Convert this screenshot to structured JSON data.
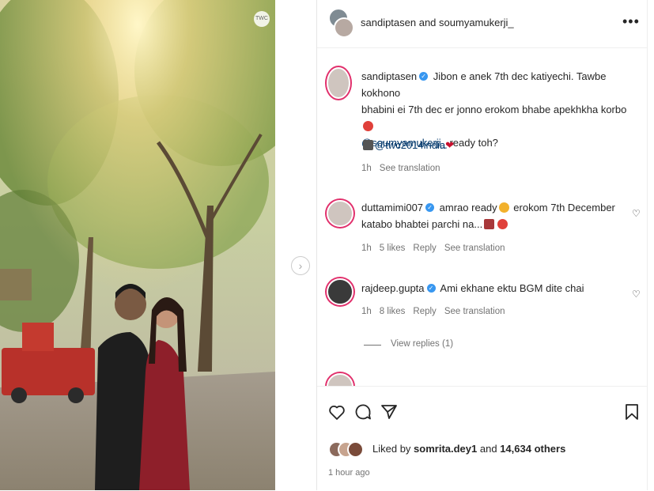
{
  "photo": {
    "watermark": "TWC"
  },
  "header": {
    "title": "sandiptasen and soumyamukerji_",
    "more_icon": "more-horizontal-icon"
  },
  "caption": {
    "user": "sandiptasen",
    "line1": "Jibon e anek 7th dec katiyechi. Tawbe kokhono",
    "line2": "bhabini ei 7th dec er jonno erokom bhabe apekhkha korbo",
    "mention": "@soumyamukerji_",
    "line3_rest": "ready toh?",
    "credit_mention": "@twc2014india",
    "time": "1h",
    "see_translation": "See translation"
  },
  "comments": [
    {
      "user": "duttamimi007",
      "line1": "amrao ready",
      "line1b": "erokom 7th December",
      "line2": "katabo bhabtei parchi na...",
      "time": "1h",
      "likes": "5 likes",
      "reply": "Reply",
      "see_translation": "See translation"
    },
    {
      "user": "rajdeep.gupta",
      "line1": "Ami ekhane ektu BGM dite chai",
      "time": "1h",
      "likes": "8 likes",
      "reply": "Reply",
      "see_translation": "See translation",
      "view_replies": "View replies (1)"
    }
  ],
  "footer": {
    "liked_prefix": "Liked by",
    "liked_user": "somrita.dey1",
    "liked_and": "and",
    "liked_others": "14,634 others",
    "time_ago": "1 hour ago"
  },
  "colors": {
    "link": "#00376b",
    "verified": "#3897f0",
    "muted": "#737373",
    "heart_red": "#ed4956"
  }
}
